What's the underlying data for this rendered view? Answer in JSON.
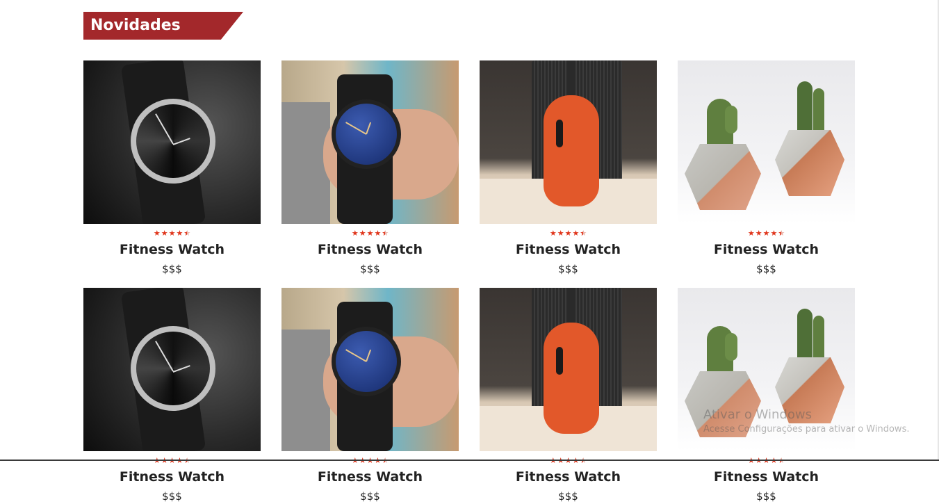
{
  "section": {
    "title": "Novidades"
  },
  "products": [
    {
      "title": "Fitness Watch",
      "price": "$$$",
      "rating": 4.5,
      "image": "black-watch"
    },
    {
      "title": "Fitness Watch",
      "price": "$$$",
      "rating": 4.5,
      "image": "blue-watch-on-wrist"
    },
    {
      "title": "Fitness Watch",
      "price": "$$$",
      "rating": 4.5,
      "image": "orange-ukulele"
    },
    {
      "title": "Fitness Watch",
      "price": "$$$",
      "rating": 4.5,
      "image": "cactus-pots"
    },
    {
      "title": "Fitness Watch",
      "price": "$$$",
      "rating": 4.5,
      "image": "black-watch"
    },
    {
      "title": "Fitness Watch",
      "price": "$$$",
      "rating": 4.5,
      "image": "blue-watch-on-wrist"
    },
    {
      "title": "Fitness Watch",
      "price": "$$$",
      "rating": 4.5,
      "image": "orange-ukulele"
    },
    {
      "title": "Fitness Watch",
      "price": "$$$",
      "rating": 4.5,
      "image": "cactus-pots"
    }
  ],
  "watermark": {
    "title": "Ativar o Windows",
    "subtitle": "Acesse Configurações para ativar o Windows."
  },
  "colors": {
    "accent": "#a3282b",
    "star": "#e0341a"
  }
}
